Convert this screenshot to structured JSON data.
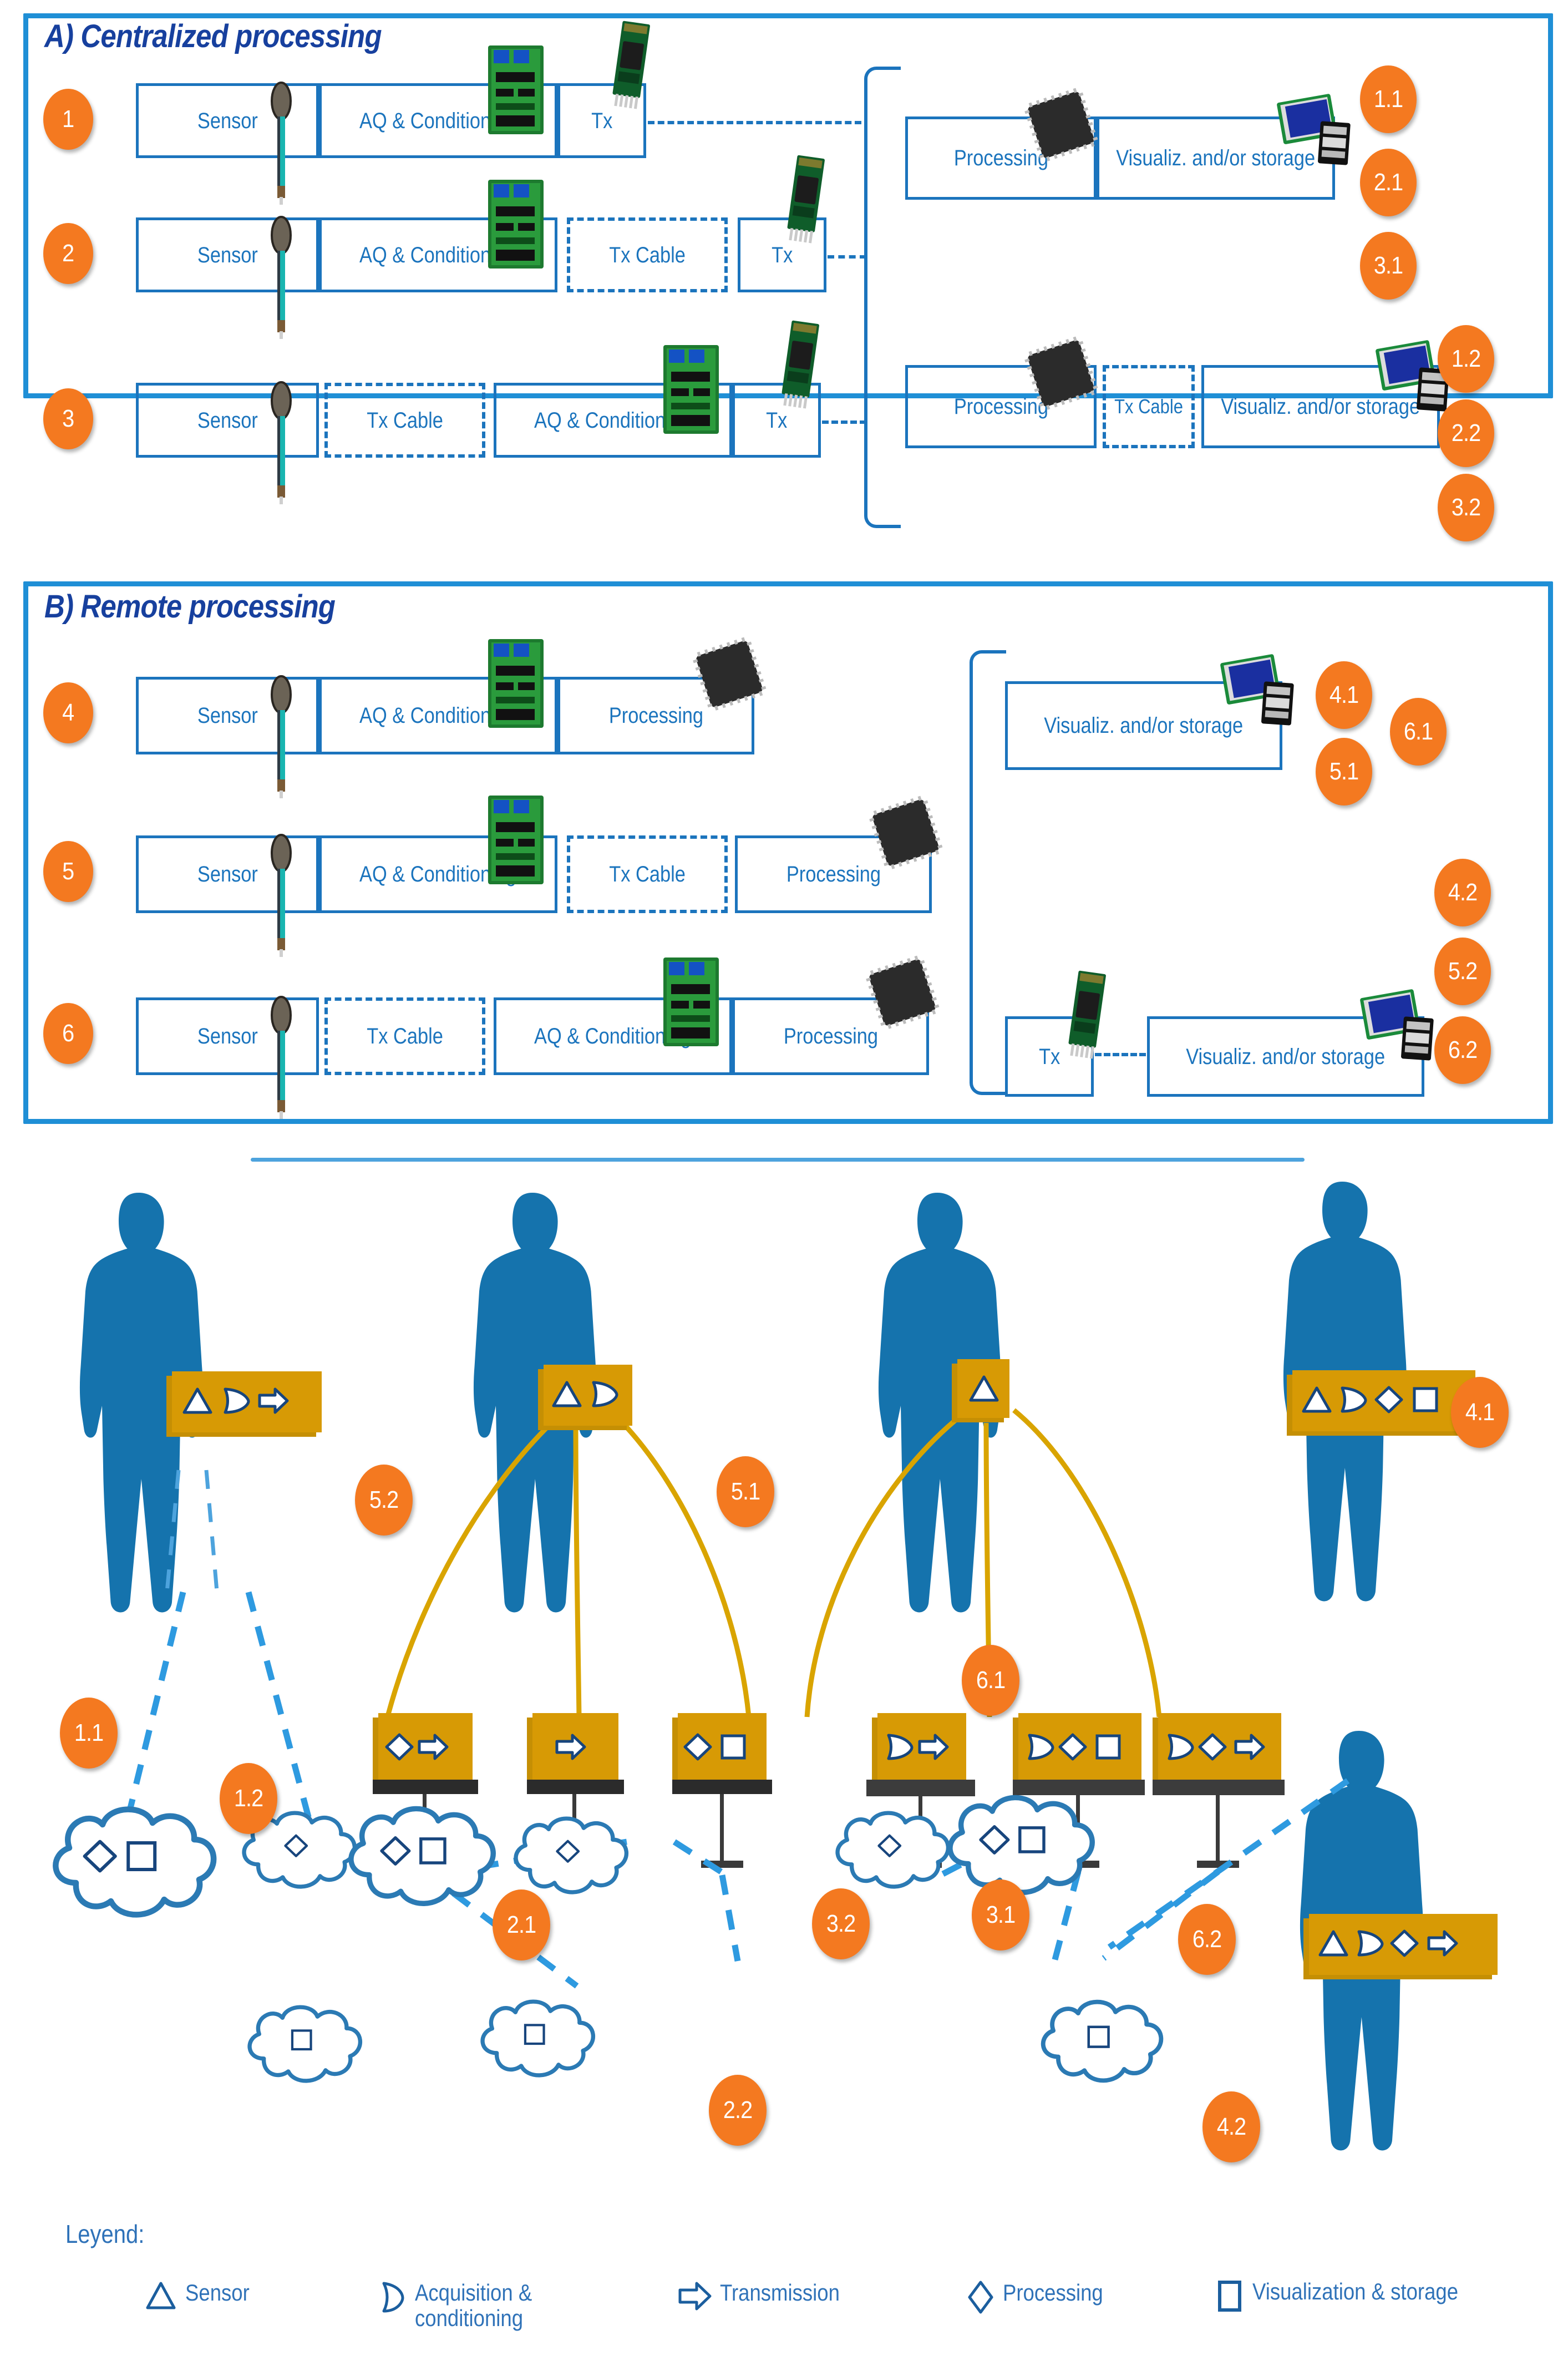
{
  "panels": [
    {
      "id": "A",
      "title": "A) Centralized processing"
    },
    {
      "id": "B",
      "title": "B) Remote processing"
    }
  ],
  "panelA": {
    "rows": [
      {
        "badge": "1",
        "left_blocks": [
          {
            "label": "Sensor",
            "dashed": false,
            "icon": "fsr-sensor-icon"
          },
          {
            "label": "AQ & Conditioning",
            "dashed": false,
            "icon": "pcb-board-icon"
          },
          {
            "label": "Tx",
            "dashed": false,
            "icon": "bluetooth-module-icon"
          }
        ]
      },
      {
        "badge": "2",
        "left_blocks": [
          {
            "label": "Sensor",
            "dashed": false,
            "icon": "fsr-sensor-icon"
          },
          {
            "label": "AQ & Conditioning",
            "dashed": false,
            "icon": "pcb-board-icon"
          },
          {
            "label": "Tx Cable",
            "dashed": true,
            "icon": null
          },
          {
            "label": "Tx",
            "dashed": false,
            "icon": "bluetooth-module-icon"
          }
        ]
      },
      {
        "badge": "3",
        "left_blocks": [
          {
            "label": "Sensor",
            "dashed": false,
            "icon": "fsr-sensor-icon"
          },
          {
            "label": "Tx Cable",
            "dashed": true,
            "icon": null
          },
          {
            "label": "AQ & Conditioning",
            "dashed": false,
            "icon": "pcb-board-icon"
          },
          {
            "label": "Tx",
            "dashed": false,
            "icon": "bluetooth-module-icon"
          }
        ]
      }
    ],
    "right_groups": [
      {
        "blocks": [
          {
            "label": "Processing",
            "dashed": false,
            "icon": "chip-icon"
          },
          {
            "label": "Visualiz. and/or storage",
            "dashed": false,
            "icon": "display-sdcard-icon"
          }
        ],
        "badges": [
          "1.1",
          "2.1",
          "3.1"
        ]
      },
      {
        "blocks": [
          {
            "label": "Processing",
            "dashed": false,
            "icon": "chip-icon"
          },
          {
            "label": "Tx Cable",
            "dashed": true,
            "icon": null
          },
          {
            "label": "Visualiz. and/or storage",
            "dashed": false,
            "icon": "display-sdcard-icon"
          }
        ],
        "badges": [
          "1.2",
          "2.2",
          "3.2"
        ]
      }
    ]
  },
  "panelB": {
    "rows": [
      {
        "badge": "4",
        "left_blocks": [
          {
            "label": "Sensor",
            "dashed": false,
            "icon": "fsr-sensor-icon"
          },
          {
            "label": "AQ & Conditioning",
            "dashed": false,
            "icon": "pcb-board-icon"
          },
          {
            "label": "Processing",
            "dashed": false,
            "icon": "chip-icon"
          }
        ]
      },
      {
        "badge": "5",
        "left_blocks": [
          {
            "label": "Sensor",
            "dashed": false,
            "icon": "fsr-sensor-icon"
          },
          {
            "label": "AQ & Conditioning",
            "dashed": false,
            "icon": "pcb-board-icon"
          },
          {
            "label": "Tx Cable",
            "dashed": true,
            "icon": null
          },
          {
            "label": "Processing",
            "dashed": false,
            "icon": "chip-icon"
          }
        ]
      },
      {
        "badge": "6",
        "left_blocks": [
          {
            "label": "Sensor",
            "dashed": false,
            "icon": "fsr-sensor-icon"
          },
          {
            "label": "Tx Cable",
            "dashed": true,
            "icon": null
          },
          {
            "label": "AQ & Conditioning",
            "dashed": false,
            "icon": "pcb-board-icon"
          },
          {
            "label": "Processing",
            "dashed": false,
            "icon": "chip-icon"
          }
        ]
      }
    ],
    "right_groups": [
      {
        "blocks": [
          {
            "label": "Visualiz. and/or storage",
            "dashed": false,
            "icon": "display-sdcard-icon"
          }
        ],
        "badges": [
          "4.1",
          "5.1",
          "6.1"
        ]
      },
      {
        "blocks": [
          {
            "label": "Tx",
            "dashed": false,
            "icon": "bluetooth-module-icon"
          },
          {
            "label": "Visualiz. and/or storage",
            "dashed": false,
            "icon": "display-sdcard-icon"
          }
        ],
        "badges": [
          "4.2",
          "5.2",
          "6.2"
        ]
      }
    ]
  },
  "scene": {
    "people": [
      {
        "id": "person-1",
        "badge": null,
        "device": {
          "icons": [
            "triangle",
            "halfmoon",
            "arrow"
          ],
          "wide": true
        }
      },
      {
        "id": "person-2",
        "badge": null,
        "device": {
          "icons": [
            "triangle",
            "halfmoon"
          ],
          "wide": false
        }
      },
      {
        "id": "person-3",
        "badge": null,
        "device": {
          "icons": [
            "triangle"
          ],
          "wide": false
        }
      },
      {
        "id": "person-4",
        "badge": "4.1",
        "device": {
          "icons": [
            "triangle",
            "halfmoon",
            "diamond",
            "square"
          ],
          "wide": true
        }
      },
      {
        "id": "person-5",
        "badge": null,
        "device": {
          "icons": [
            "triangle",
            "halfmoon",
            "diamond",
            "arrow"
          ],
          "wide": true
        }
      }
    ],
    "tabletop_devices": [
      {
        "id": "dev-1",
        "icons": [
          "diamond",
          "arrow"
        ]
      },
      {
        "id": "dev-2",
        "icons": [
          "arrow"
        ]
      },
      {
        "id": "dev-3",
        "icons": [
          "diamond",
          "square"
        ]
      },
      {
        "id": "dev-4",
        "icons": [
          "halfmoon",
          "arrow"
        ]
      },
      {
        "id": "dev-5",
        "icons": [
          "halfmoon",
          "diamond",
          "square"
        ]
      },
      {
        "id": "dev-6",
        "icons": [
          "halfmoon",
          "diamond",
          "arrow"
        ]
      }
    ],
    "clouds": [
      {
        "id": "cloud-1",
        "icons": [
          "diamond",
          "square"
        ],
        "size": "big"
      },
      {
        "id": "cloud-2",
        "icons": [
          "diamond"
        ],
        "size": "small"
      },
      {
        "id": "cloud-3",
        "icons": [
          "square"
        ],
        "size": "small"
      },
      {
        "id": "cloud-4",
        "icons": [
          "diamond",
          "square"
        ],
        "size": "big"
      },
      {
        "id": "cloud-5",
        "icons": [
          "diamond"
        ],
        "size": "small"
      },
      {
        "id": "cloud-6",
        "icons": [
          "square"
        ],
        "size": "small"
      },
      {
        "id": "cloud-7",
        "icons": [
          "diamond"
        ],
        "size": "small"
      },
      {
        "id": "cloud-8",
        "icons": [
          "diamond",
          "square"
        ],
        "size": "big"
      },
      {
        "id": "cloud-9",
        "icons": [
          "square"
        ],
        "size": "small"
      }
    ],
    "badges": [
      {
        "label": "5.2"
      },
      {
        "label": "5.1"
      },
      {
        "label": "6.1"
      },
      {
        "label": "4.1"
      },
      {
        "label": "1.1"
      },
      {
        "label": "1.2"
      },
      {
        "label": "2.1"
      },
      {
        "label": "2.2"
      },
      {
        "label": "3.2"
      },
      {
        "label": "3.1"
      },
      {
        "label": "6.2"
      },
      {
        "label": "4.2"
      }
    ]
  },
  "legend": {
    "title": "Leyend:",
    "items": [
      {
        "icon": "triangle",
        "label": "Sensor"
      },
      {
        "icon": "halfmoon",
        "label": "Acquisition & conditioning"
      },
      {
        "icon": "arrow",
        "label": "Transmission"
      },
      {
        "icon": "diamond",
        "label": "Processing"
      },
      {
        "icon": "square",
        "label": "Visualization & storage"
      }
    ]
  },
  "colors": {
    "panel_border": "#1f8fd6",
    "box_border": "#1b74bd",
    "text_blue": "#1b74bd",
    "title_blue": "#17409e",
    "badge_orange": "#f47920",
    "device_gold": "#d79a05",
    "person_blue": "#1573ad",
    "wire_gold": "#d9a400",
    "dash_blue": "#2e9ae0"
  }
}
